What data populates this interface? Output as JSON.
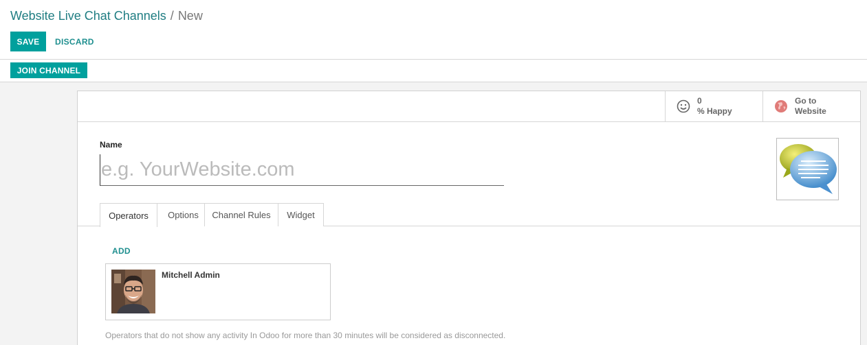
{
  "breadcrumb": {
    "parent": "Website Live Chat Channels",
    "separator": "/",
    "current": "New"
  },
  "toolbar": {
    "save_label": "SAVE",
    "discard_label": "DISCARD"
  },
  "statusbar": {
    "join_label": "JOIN CHANNEL"
  },
  "stat_buttons": {
    "happy": {
      "value": "0",
      "label": "% Happy",
      "icon": "smiley-icon"
    },
    "website": {
      "line1": "Go to",
      "line2": "Website",
      "icon": "globe-icon",
      "icon_color": "#d9534f"
    }
  },
  "form": {
    "name_label": "Name",
    "name_value": "",
    "name_placeholder": "e.g. YourWebsite.com",
    "image_icon": "chat-bubbles-icon"
  },
  "tabs": [
    {
      "label": "Operators",
      "active": true
    },
    {
      "label": "Options",
      "active": false
    },
    {
      "label": "Channel Rules",
      "active": false
    },
    {
      "label": "Widget",
      "active": false
    }
  ],
  "operators": {
    "add_label": "ADD",
    "items": [
      {
        "name": "Mitchell Admin"
      }
    ],
    "help_text": "Operators that do not show any activity In Odoo for more than 30 minutes will be considered as disconnected."
  },
  "colors": {
    "primary": "#00a09d",
    "link": "#1f8f8f",
    "breadcrumb_link": "#1f7d82"
  }
}
